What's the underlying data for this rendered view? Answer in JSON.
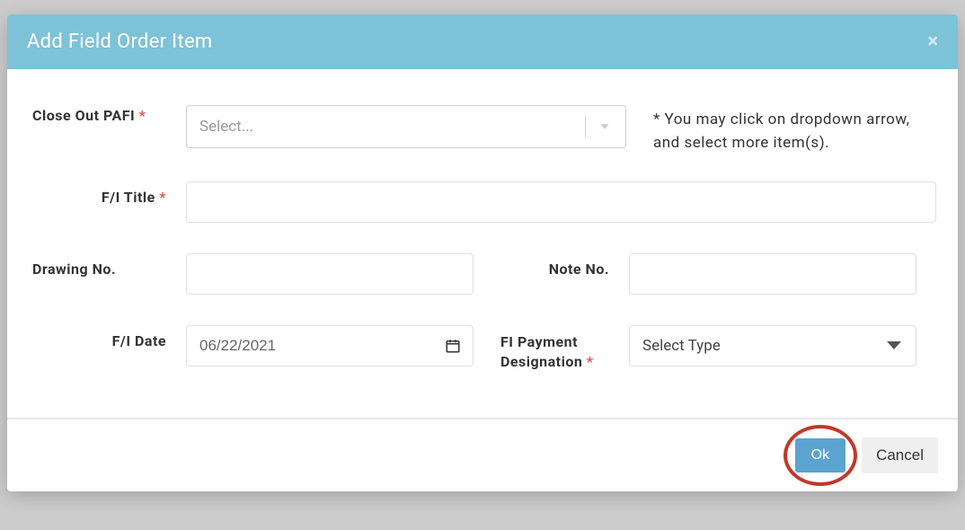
{
  "modal": {
    "title": "Add Field Order Item"
  },
  "labels": {
    "close_out_pafi": "Close Out PAFI",
    "fi_title": "F/I Title",
    "drawing_no": "Drawing No.",
    "note_no": "Note No.",
    "fi_date": "F/I Date",
    "fi_payment": "FI Payment Designation"
  },
  "placeholders": {
    "select": "Select...",
    "select_type": "Select Type"
  },
  "values": {
    "fi_date": "06/22/2021"
  },
  "hint": "* You may click on dropdown arrow, and select more item(s).",
  "buttons": {
    "ok": "Ok",
    "cancel": "Cancel"
  }
}
